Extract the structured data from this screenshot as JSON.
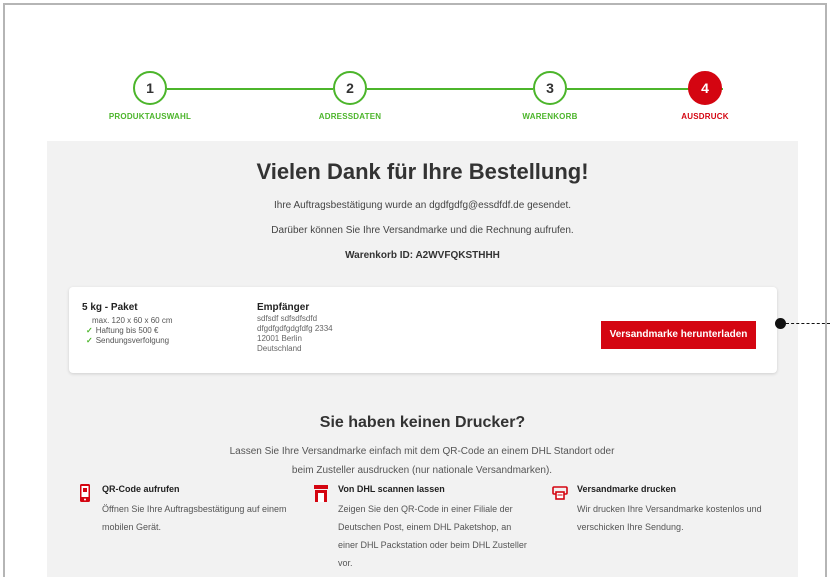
{
  "stepper": {
    "steps": [
      {
        "number": "1",
        "label": "PRODUKTAUSWAHL"
      },
      {
        "number": "2",
        "label": "ADRESSDATEN"
      },
      {
        "number": "3",
        "label": "WARENKORB"
      },
      {
        "number": "4",
        "label": "AUSDRUCK"
      }
    ],
    "active_step": 4
  },
  "confirmation": {
    "title": "Vielen Dank für Ihre Bestellung!",
    "email_text": "Ihre Auftragsbestätigung wurde an dgdfgdfg@essdfdf.de gesendet.",
    "info_text": "Darüber können Sie Ihre Versandmarke und die Rechnung aufrufen.",
    "cart_id": "Warenkorb ID: A2WVFQKSTHHH"
  },
  "order_card": {
    "product": {
      "name": "5 kg - Paket",
      "dimensions": "max. 120 x 60 x 60 cm",
      "features": [
        "Haftung bis 500 €",
        "Sendungsverfolgung"
      ]
    },
    "recipient": {
      "heading": "Empfänger",
      "lines": [
        "sdfsdf sdfsdfsdfd",
        "dfgdfgdfgdgfdfg 2334",
        "12001 Berlin",
        "Deutschland"
      ]
    },
    "download_button": "Versandmarke herunterladen"
  },
  "no_printer": {
    "title": "Sie haben keinen Drucker?",
    "text": "Lassen Sie Ihre Versandmarke einfach mit dem QR-Code an einem DHL Standort oder beim Zusteller ausdrucken (nur nationale Versandmarken).",
    "features": [
      {
        "icon": "mobile-phone-icon",
        "title": "QR-Code aufrufen",
        "text": "Öffnen Sie Ihre Auftragsbestätigung auf einem mobilen Gerät."
      },
      {
        "icon": "store-icon",
        "title": "Von DHL scannen lassen",
        "text": "Zeigen Sie den QR-Code in einer Filiale der Deutschen Post, einem DHL Paketshop, an einer DHL Packstation oder beim DHL Zusteller vor."
      },
      {
        "icon": "printer-icon",
        "title": "Versandmarke drucken",
        "text": "Wir drucken Ihre Versandmarke kostenlos und verschicken Ihre Sendung."
      }
    ]
  },
  "colors": {
    "accent_red": "#d40511",
    "success_green": "#4cb52b",
    "panel_grey": "#f2f2f2"
  }
}
